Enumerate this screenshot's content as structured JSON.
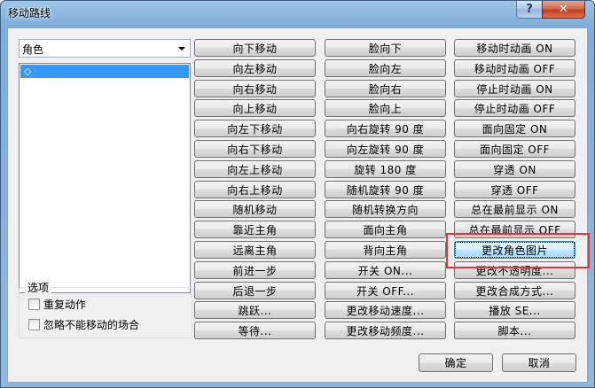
{
  "window": {
    "title": "移动路线",
    "help_label": "?",
    "close_label": "✕"
  },
  "combo": {
    "value": "角色"
  },
  "listbox": {
    "items": [
      "◇"
    ]
  },
  "options": {
    "title": "选项",
    "repeat_label": "重复动作",
    "ignore_label": "忽略不能移动的场合"
  },
  "col1": [
    "向下移动",
    "向左移动",
    "向右移动",
    "向上移动",
    "向左下移动",
    "向右下移动",
    "向左上移动",
    "向右上移动",
    "随机移动",
    "靠近主角",
    "远离主角",
    "前进一步",
    "后退一步",
    "跳跃...",
    "等待..."
  ],
  "col2": [
    "脸向下",
    "脸向左",
    "脸向右",
    "脸向上",
    "向右旋转 90 度",
    "向左旋转 90 度",
    "旋转 180 度",
    "随机旋转 90 度",
    "随机转换方向",
    "面向主角",
    "背向主角",
    "开关 ON...",
    "开关 OFF...",
    "更改移动速度...",
    "更改移动频度..."
  ],
  "col3": [
    "移动时动画 ON",
    "移动时动画 OFF",
    "停止时动画 ON",
    "停止时动画 OFF",
    "面向固定 ON",
    "面向固定 OFF",
    "穿透 ON",
    "穿透 OFF",
    "总在最前显示 ON",
    "总在最前显示 OFF",
    "更改角色图片",
    "更改不透明度...",
    "更改合成方式...",
    "播放 SE...",
    "脚本..."
  ],
  "buttons": {
    "ok": "确定",
    "cancel": "取消"
  },
  "colors": {
    "highlight": "#e5343a",
    "selection": "#3399ff"
  }
}
